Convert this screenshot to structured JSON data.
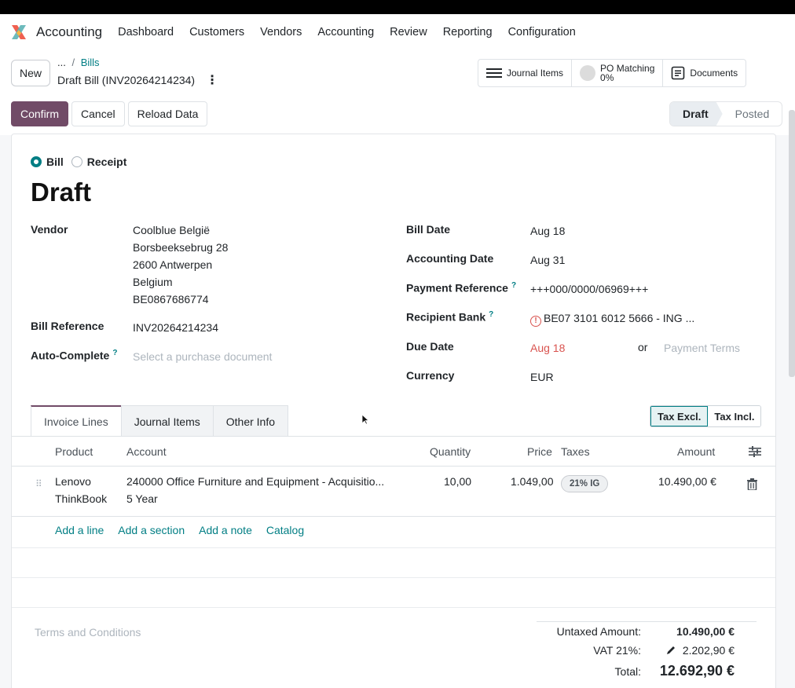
{
  "navbar": {
    "app_name": "Accounting",
    "menu": [
      "Dashboard",
      "Customers",
      "Vendors",
      "Accounting",
      "Review",
      "Reporting",
      "Configuration"
    ]
  },
  "control": {
    "new_label": "New",
    "breadcrumb_more": "...",
    "breadcrumb_parent": "Bills",
    "record_title": "Draft Bill (INV20264214234)",
    "smart_journal": "Journal Items",
    "smart_po_label": "PO Matching",
    "smart_po_value": "0%",
    "smart_documents": "Documents",
    "confirm": "Confirm",
    "cancel": "Cancel",
    "reload": "Reload Data",
    "status_draft": "Draft",
    "status_posted": "Posted"
  },
  "form": {
    "type_bill": "Bill",
    "type_receipt": "Receipt",
    "state_title": "Draft",
    "vendor_label": "Vendor",
    "vendor_lines": [
      "Coolblue België",
      "Borsbeeksebrug 28",
      "2600 Antwerpen",
      "Belgium",
      "BE0867686774"
    ],
    "bill_ref_label": "Bill Reference",
    "bill_ref_value": "INV20264214234",
    "autocomplete_label": "Auto-Complete",
    "autocomplete_placeholder": "Select a purchase document",
    "bill_date_label": "Bill Date",
    "bill_date_value": "Aug 18",
    "accounting_date_label": "Accounting Date",
    "accounting_date_value": "Aug 31",
    "payment_ref_label": "Payment Reference",
    "payment_ref_value": "+++000/0000/06969+++",
    "recipient_bank_label": "Recipient Bank",
    "recipient_bank_value": "BE07 3101 6012 5666 - ING ...",
    "due_date_label": "Due Date",
    "due_date_value": "Aug 18",
    "or_text": "or",
    "payment_terms_placeholder": "Payment Terms",
    "currency_label": "Currency",
    "currency_value": "EUR",
    "help_mark": "?"
  },
  "tabs": [
    "Invoice Lines",
    "Journal Items",
    "Other Info"
  ],
  "tax_toggle": {
    "excl": "Tax Excl.",
    "incl": "Tax Incl."
  },
  "table": {
    "headers": {
      "product": "Product",
      "account": "Account",
      "quantity": "Quantity",
      "price": "Price",
      "taxes": "Taxes",
      "amount": "Amount"
    },
    "row": {
      "product_1": "Lenovo",
      "product_2": "ThinkBook",
      "account_1": "240000 Office Furniture and Equipment - Acquisitio...",
      "account_2": "5 Year",
      "quantity": "10,00",
      "price": "1.049,00",
      "tax": "21% IG",
      "amount": "10.490,00 €"
    }
  },
  "add_links": [
    "Add a line",
    "Add a section",
    "Add a note",
    "Catalog"
  ],
  "terms_placeholder": "Terms and Conditions",
  "totals": {
    "untaxed_label": "Untaxed Amount:",
    "untaxed_value": "10.490,00 €",
    "vat_label": "VAT 21%:",
    "vat_value": "2.202,90 €",
    "total_label": "Total:",
    "total_value": "12.692,90 €"
  }
}
